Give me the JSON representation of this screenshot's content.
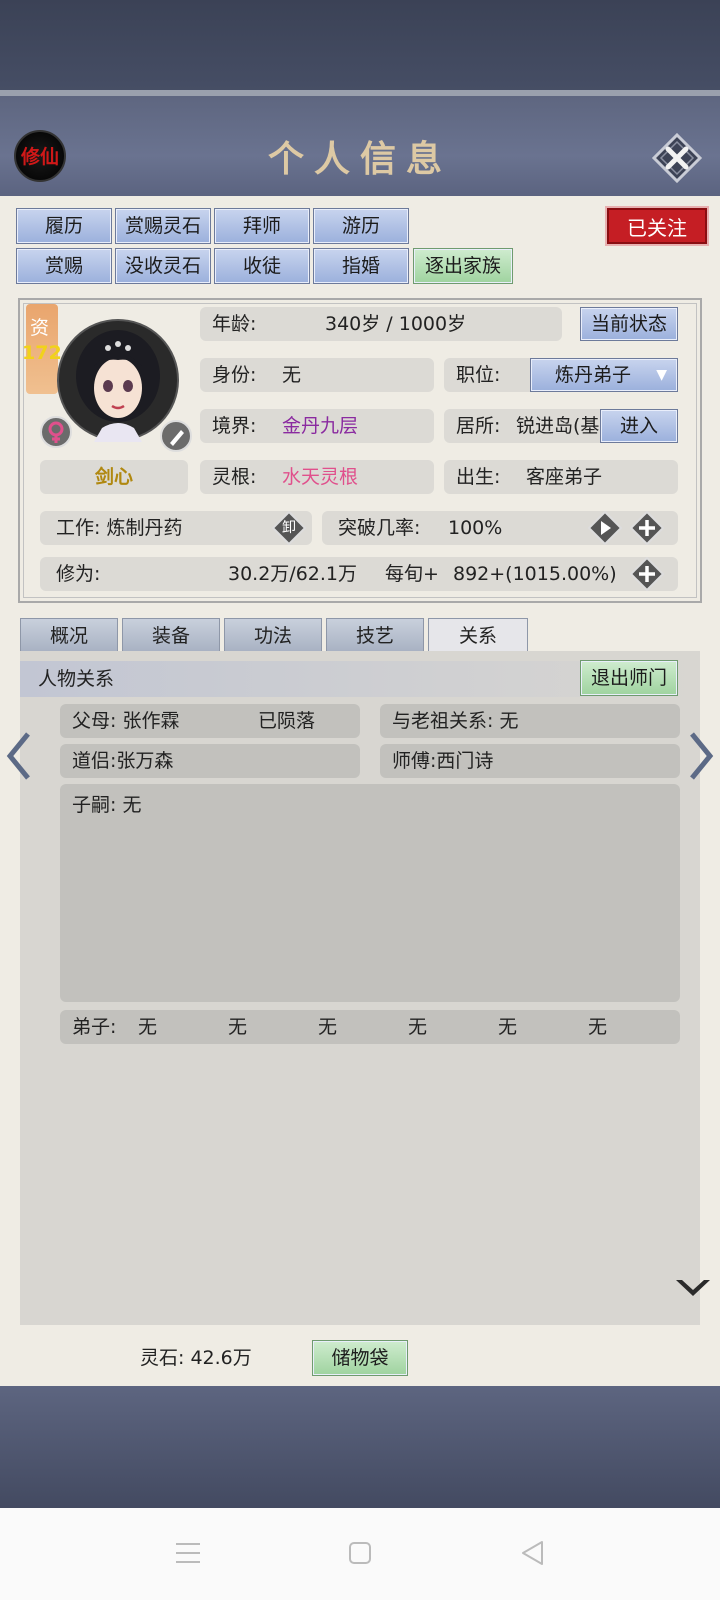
{
  "header": {
    "title": "个人信息",
    "logo_text": "修仙"
  },
  "top_buttons_row1": [
    "履历",
    "赏赐灵石",
    "拜师",
    "游历"
  ],
  "top_buttons_row2": [
    "赏赐",
    "没收灵石",
    "收徒",
    "指婚",
    "逐出家族"
  ],
  "followed_label": "已关注",
  "character": {
    "aptitude_label": "资",
    "aptitude_value": "172",
    "talent": "剑心",
    "age_label": "年龄:",
    "age_value": "340岁 / 1000岁",
    "status_button": "当前状态",
    "identity_label": "身份:",
    "identity_value": "无",
    "position_label": "职位:",
    "position_value": "炼丹弟子",
    "realm_label": "境界:",
    "realm_value": "金丹九层",
    "residence_label": "居所:",
    "residence_value": "锐进岛(基",
    "enter_button": "进入",
    "root_label": "灵根:",
    "root_value": "水天灵根",
    "birth_label": "出生:",
    "birth_value": "客座弟子",
    "work_label": "工作:",
    "work_value": "炼制丹药",
    "unload_icon_text": "卸",
    "breakthrough_label": "突破几率:",
    "breakthrough_value": "100%",
    "cultivation_label": "修为:",
    "cultivation_value": "30.2万/62.1万",
    "per_turn_label": "每旬+",
    "per_turn_value": "892+(1015.00%)"
  },
  "tabs": [
    "概况",
    "装备",
    "功法",
    "技艺",
    "关系"
  ],
  "active_tab": "关系",
  "relations": {
    "section_title": "人物关系",
    "leave_master_button": "退出师门",
    "parents": "父母: 张作霖",
    "parents_status": "已陨落",
    "ancestor": "与老祖关系: 无",
    "partner": "道侣:张万森",
    "master": "师傅:西门诗",
    "children": "子嗣: 无",
    "disciples_label": "弟子:",
    "disciples": [
      "无",
      "无",
      "无",
      "无",
      "无",
      "无"
    ]
  },
  "footer": {
    "spirit_stones": "灵石: 42.6万",
    "storage_bag_button": "储物袋"
  },
  "colors": {
    "accent_red": "#c51e24",
    "purple": "#8a2aa0",
    "pink": "#e0508c"
  }
}
